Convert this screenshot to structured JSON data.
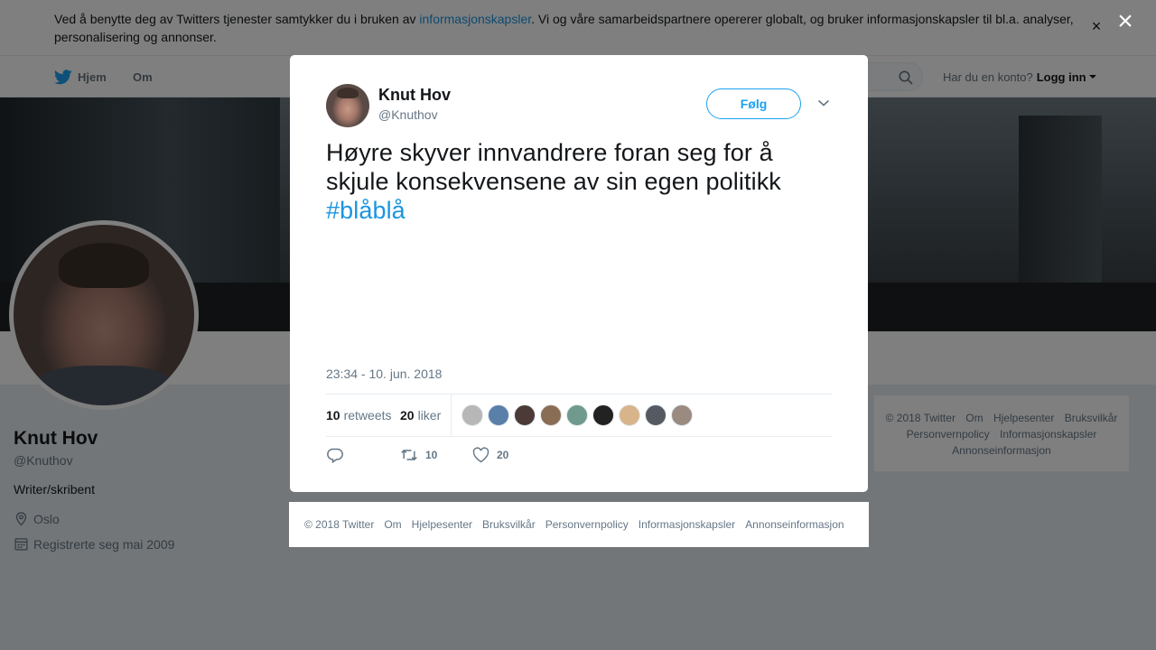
{
  "cookie": {
    "text_before": "Ved å benytte deg av Twitters tjenester samtykker du i bruken av ",
    "link": "informasjonskapsler",
    "text_after": ". Vi og våre samarbeidspartnere opererer globalt, og bruker informasjonskapsler til bl.a. analyser, personalisering og annonser.",
    "close": "×"
  },
  "nav": {
    "home": "Hjem",
    "about": "Om",
    "login_prompt": "Har du en konto?",
    "login": "Logg inn"
  },
  "profile": {
    "name": "Knut Hov",
    "handle": "@Knuthov",
    "bio": "Writer/skribent",
    "location": "Oslo",
    "joined": "Registrerte seg mai 2009"
  },
  "side_footer": {
    "items": [
      "© 2018 Twitter",
      "Om",
      "Hjelpesenter",
      "Bruksvilkår",
      "Personvernpolicy",
      "Informasjonskapsler",
      "Annonseinformasjon"
    ]
  },
  "overlay": {
    "close": "×"
  },
  "tweet": {
    "name": "Knut Hov",
    "handle": "@Knuthov",
    "follow": "Følg",
    "text": "Høyre skyver innvandrere foran seg for å skjule konsekvensene av sin egen politikk",
    "hashtag": "#blåblå",
    "time": "23:34 - 10. jun. 2018",
    "retweets_count": "10",
    "retweets_label": "retweets",
    "likes_count": "20",
    "likes_label": "liker",
    "likers": [
      "#b7b7b7",
      "#5a7fa8",
      "#4b3a35",
      "#8a6d55",
      "#6f9a8d",
      "#222222",
      "#d8b48a",
      "#555a60",
      "#9a8a80"
    ],
    "action_retweets": "10",
    "action_likes": "20"
  },
  "modal_footer": {
    "items": [
      "© 2018 Twitter",
      "Om",
      "Hjelpesenter",
      "Bruksvilkår",
      "Personvernpolicy",
      "Informasjonskapsler",
      "Annonseinformasjon"
    ]
  },
  "colors": {
    "twitter_blue": "#1da1f2",
    "link_blue": "#1b95e0",
    "text_gray": "#657786"
  }
}
